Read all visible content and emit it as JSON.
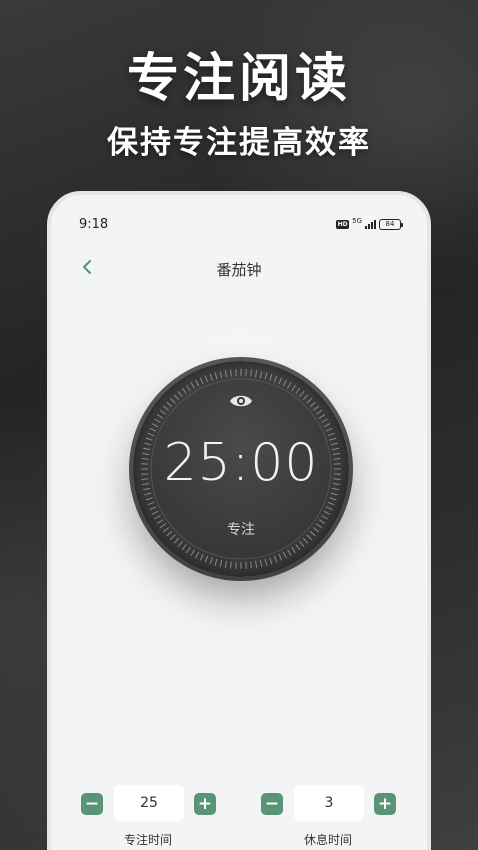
{
  "promo": {
    "headline": "专注阅读",
    "subline": "保持专注提高效率"
  },
  "status_bar": {
    "time": "9:18",
    "hd": "HD",
    "network": "5G",
    "battery": "84",
    "icons": [
      "hd-icon",
      "signal-icon",
      "battery-icon"
    ]
  },
  "nav": {
    "title": "番茄钟",
    "back_icon": "chevron-left-icon"
  },
  "timer": {
    "time": "25:00",
    "mode": "专注",
    "icon": "eye-icon"
  },
  "settings": {
    "focus": {
      "value": "25",
      "label": "专注时间",
      "minus": "−",
      "plus": "+"
    },
    "rest": {
      "value": "3",
      "label": "休息时间",
      "minus": "−",
      "plus": "+"
    }
  },
  "colors": {
    "accent": "#5a9476",
    "dial": "#3a3a3a",
    "screen_bg": "#f3f4f6"
  }
}
